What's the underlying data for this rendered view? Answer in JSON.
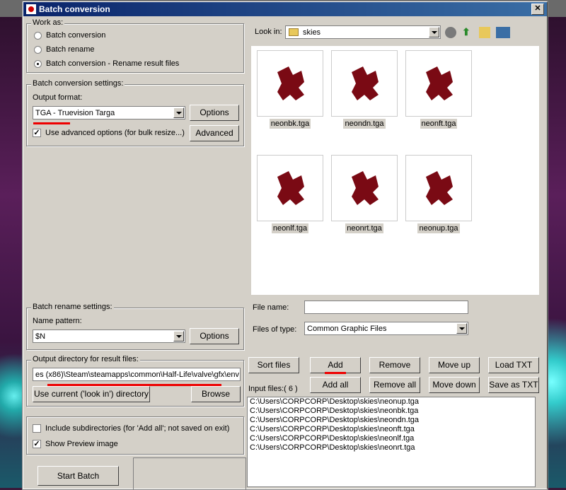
{
  "window": {
    "title": "Batch conversion"
  },
  "work_as": {
    "label": "Work as:",
    "options": [
      "Batch conversion",
      "Batch rename",
      "Batch conversion - Rename result files"
    ]
  },
  "conversion": {
    "label": "Batch conversion settings:",
    "format_label": "Output format:",
    "format_value": "TGA - Truevision Targa",
    "options_button": "Options",
    "advanced_check": "Use advanced options (for bulk resize...)",
    "advanced_button": "Advanced"
  },
  "rename": {
    "label": "Batch rename settings:",
    "pattern_label": "Name pattern:",
    "pattern_value": "$N",
    "options_button": "Options"
  },
  "output": {
    "label": "Output directory for result files:",
    "path": "es (x86)\\Steam\\steamapps\\common\\Half-Life\\valve\\gfx\\env",
    "use_current_button": "Use current ('look in') directory",
    "browse_button": "Browse"
  },
  "extras": {
    "include_sub": "Include subdirectories (for 'Add all'; not saved on exit)",
    "show_preview": "Show Preview image"
  },
  "start_button": "Start Batch",
  "browser": {
    "look_in_label": "Look in:",
    "folder": "skies",
    "files": [
      "neonbk.tga",
      "neondn.tga",
      "neonft.tga",
      "neonlf.tga",
      "neonrt.tga",
      "neonup.tga"
    ],
    "file_name_label": "File name:",
    "file_name_value": "",
    "file_type_label": "Files of type:",
    "file_type_value": "Common Graphic Files"
  },
  "actions": {
    "sort": "Sort files",
    "add": "Add",
    "remove": "Remove",
    "move_up": "Move up",
    "load_txt": "Load TXT",
    "add_all": "Add all",
    "remove_all": "Remove all",
    "move_down": "Move down",
    "save_txt": "Save as TXT"
  },
  "input_files": {
    "label": "Input files:( 6 )",
    "items": [
      "C:\\Users\\CORPCORP\\Desktop\\skies\\neonup.tga",
      "C:\\Users\\CORPCORP\\Desktop\\skies\\neonbk.tga",
      "C:\\Users\\CORPCORP\\Desktop\\skies\\neondn.tga",
      "C:\\Users\\CORPCORP\\Desktop\\skies\\neonft.tga",
      "C:\\Users\\CORPCORP\\Desktop\\skies\\neonlf.tga",
      "C:\\Users\\CORPCORP\\Desktop\\skies\\neonrt.tga"
    ]
  },
  "colors": {
    "title_bar": "#0a246a",
    "face": "#d4d0c8",
    "annotation": "#e00000",
    "puzzle_icon": "#7a0a14"
  }
}
